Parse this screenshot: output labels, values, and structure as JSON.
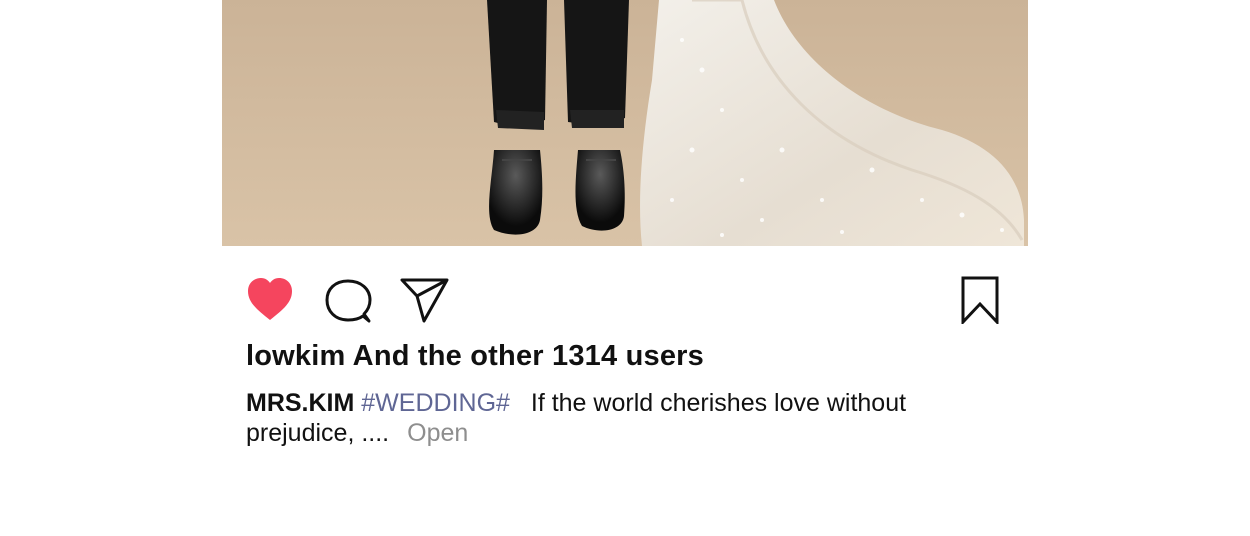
{
  "post": {
    "likes_text": "lowkim And the other 1314 users",
    "caption": {
      "author": "MRS.KIM",
      "hashtag": "#WEDDING#",
      "text_line1": "If the world cherishes love without",
      "text_line2": "prejudice, ....",
      "open_label": "Open"
    }
  },
  "icons": {
    "like": "heart-icon",
    "comment": "speech-bubble-icon",
    "share": "paper-plane-icon",
    "save": "bookmark-icon"
  },
  "colors": {
    "like_active": "#f5455e",
    "hashtag": "#5f6694",
    "open_link": "#8e8e8e",
    "photo_background": "#d3bca0"
  }
}
